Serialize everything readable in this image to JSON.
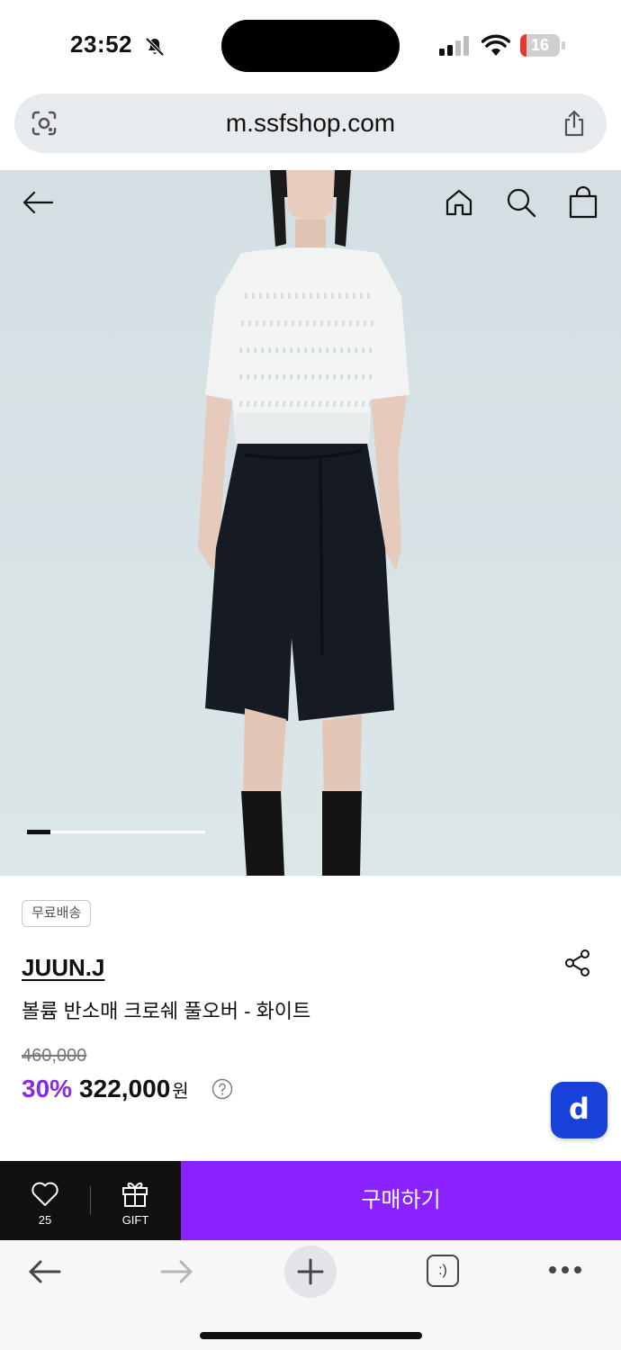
{
  "status_bar": {
    "time": "23:52",
    "battery": "16",
    "battery_level": 0.16,
    "icons": [
      "bell-slash-icon",
      "signal-icon",
      "wifi-icon",
      "battery-icon"
    ]
  },
  "url_bar": {
    "url": "m.ssfshop.com",
    "left_icon": "lens-icon",
    "right_icon": "share-icon"
  },
  "header": {
    "icons": [
      "back-arrow-icon",
      "home-icon",
      "search-icon",
      "shopping-bag-icon"
    ]
  },
  "gallery": {
    "current_slide_fraction": 0.13
  },
  "product": {
    "badge": "무료배송",
    "brand": "JUUN.J",
    "name": "볼륨 반소매 크로쉐 풀오버 - 화이트",
    "original_price": "460,000",
    "discount": "30%",
    "price": "322,000",
    "currency": "원",
    "help_icon": "question-circle-icon"
  },
  "floating_button": {
    "label": "d",
    "color": "#1741d9"
  },
  "buy_bar": {
    "wish_count": "25",
    "gift_label": "GIFT",
    "buy_label": "구매하기",
    "buy_color": "#8a22ff"
  },
  "browser_toolbar": {
    "tabs_label": ":)",
    "icons": [
      "back-icon",
      "forward-icon",
      "plus-icon",
      "tabs-icon",
      "more-icon"
    ]
  }
}
